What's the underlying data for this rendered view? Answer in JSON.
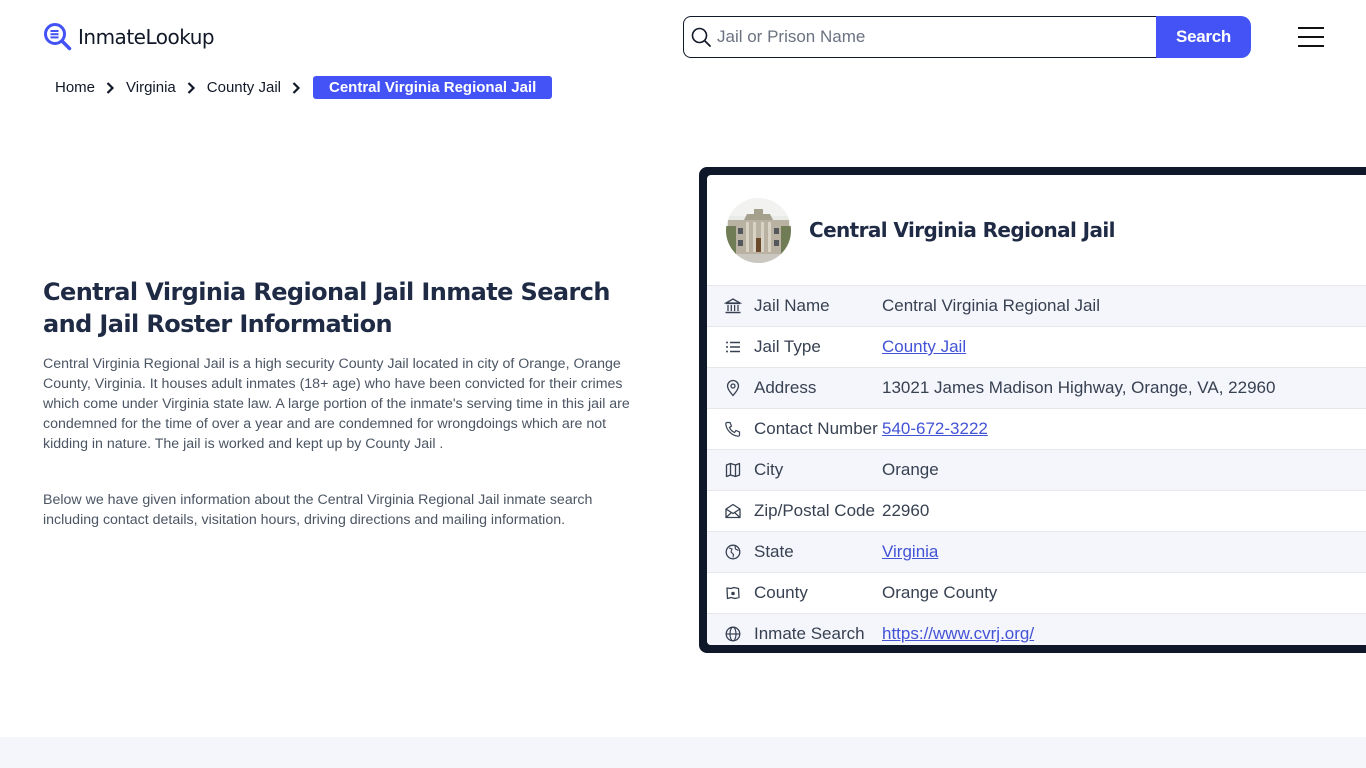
{
  "header": {
    "logo_text": "InmateLookup",
    "search": {
      "placeholder": "Jail or Prison Name",
      "value": "",
      "button_label": "Search"
    },
    "menu_icon": "hamburger-menu-icon"
  },
  "breadcrumb": {
    "items": [
      {
        "label": "Home"
      },
      {
        "label": "Virginia"
      },
      {
        "label": "County Jail"
      }
    ],
    "current": "Central Virginia Regional Jail"
  },
  "main": {
    "title": "Central Virginia Regional Jail Inmate Search and Jail Roster Information",
    "paragraphs": [
      "Central Virginia Regional Jail is a high security County Jail located in city of Orange, Orange County, Virginia. It houses adult inmates (18+ age) who have been convicted for their crimes which come under Virginia state law. A large portion of the inmate's serving time in this jail are condemned for the time of over a year and are condemned for wrongdoings which are not kidding in nature. The jail is worked and kept up by County Jail .",
      "Below we have given information about the Central Virginia Regional Jail inmate search including contact details, visitation hours, driving directions and mailing information."
    ]
  },
  "card": {
    "title": "Central Virginia Regional Jail",
    "image_alt": "jail-building-photo",
    "rows": [
      {
        "icon": "bank-building-icon",
        "label": "Jail Name",
        "value": "Central Virginia Regional Jail",
        "link": false
      },
      {
        "icon": "list-icon",
        "label": "Jail Type",
        "value": "County Jail",
        "link": true
      },
      {
        "icon": "map-pin-icon",
        "label": "Address",
        "value": "13021 James Madison Highway, Orange, VA, 22960",
        "link": false
      },
      {
        "icon": "phone-icon",
        "label": "Contact Number",
        "value": "540-672-3222",
        "link": true
      },
      {
        "icon": "map-icon",
        "label": "City",
        "value": "Orange",
        "link": false
      },
      {
        "icon": "mail-open-icon",
        "label": "Zip/Postal Code",
        "value": "22960",
        "link": false
      },
      {
        "icon": "globe-region-icon",
        "label": "State",
        "value": "Virginia",
        "link": true
      },
      {
        "icon": "county-map-icon",
        "label": "County",
        "value": "Orange County",
        "link": false
      },
      {
        "icon": "globe-icon",
        "label": "Inmate Search",
        "value": "https://www.cvrj.org/",
        "link": true
      }
    ]
  },
  "colors": {
    "accent": "#4353f5",
    "card_border": "#0f172a",
    "heading": "#1f2a44",
    "link": "#4353d6",
    "row_shade": "#f5f6fc"
  }
}
